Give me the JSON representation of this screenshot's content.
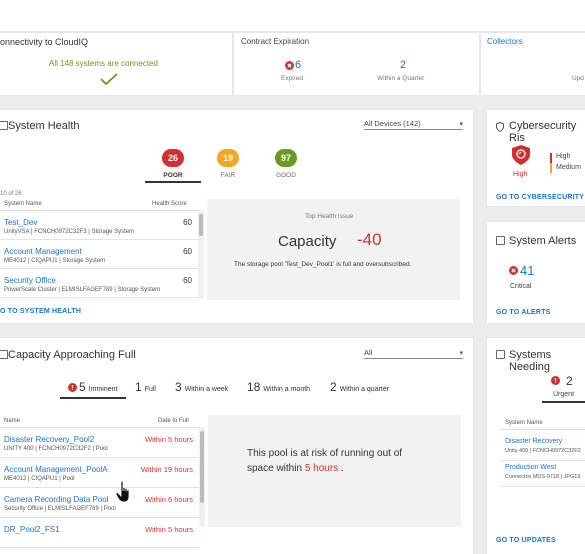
{
  "top": {
    "connectivity_title": "onnectivity to CloudIQ",
    "connectivity_status": "All 148 systems are connected",
    "contract_title": "Contract Expiration",
    "expired_count": "6",
    "expired_label": "Expired",
    "quarter_count": "2",
    "quarter_label": "Within a Quarter",
    "collectors_title": "Collectors",
    "collectors_sub": "Upd"
  },
  "system_health": {
    "title": "System Health",
    "filter": "All Devices (142)",
    "scores": [
      {
        "value": "26",
        "label": "POOR",
        "color": "#d32f2f"
      },
      {
        "value": "19",
        "label": "FAIR",
        "color": "#f5a623"
      },
      {
        "value": "97",
        "label": "GOOD",
        "color": "#6a9a1f"
      }
    ],
    "count_text": "10 of 26",
    "col_name": "System Name",
    "col_score": "Health Score",
    "rows": [
      {
        "name": "Test_Dev",
        "sub": "UnityVSA | FCNCH0972C32F3 | Storage System",
        "score": "60"
      },
      {
        "name": "Account Management",
        "sub": "ME4012 | CIQAPU1 | Storage System",
        "score": "60"
      },
      {
        "name": "Security Office",
        "sub": "PowerScale Cluster | ELMISLFAGEF789 | Storage System",
        "score": "60"
      }
    ],
    "issue_heading": "Top Health Issue",
    "issue_category": "Capacity",
    "issue_score": "-40",
    "issue_text": "The storage pool 'Test_Dev_Pool1' is full and oversubscribed.",
    "link": "O TO SYSTEM HEALTH"
  },
  "capacity": {
    "title": "Capacity Approaching Full",
    "filter": "All",
    "tabs": [
      {
        "count": "5",
        "label": "Imminent"
      },
      {
        "count": "1",
        "label": "Full"
      },
      {
        "count": "3",
        "label": "Within a week"
      },
      {
        "count": "18",
        "label": "Within a month"
      },
      {
        "count": "2",
        "label": "Within a quarter"
      }
    ],
    "col_name": "Name",
    "col_date": "Date to Full",
    "rows": [
      {
        "name": "Disaster Recovery_Pool2",
        "sub": "UNITY 400 | FCNCH0972C32F2 | Pool",
        "date": "Within 5 hours"
      },
      {
        "name": "Account Management_PoolA",
        "sub": "ME4012 | CIQAPU1 | Pool",
        "date": "Within 19 hours"
      },
      {
        "name": "Camera Recording Data Pool",
        "sub": "Security Office | ELMISLFAGEF789 | Pool",
        "date": "Within 6 hours"
      },
      {
        "name": "DR_Pool2_FS1",
        "sub": "",
        "date": "Within 5 hours"
      }
    ],
    "detail_text_1": "This pool is at risk of running out of",
    "detail_text_2": "space within ",
    "detail_highlight": "5 hours",
    "detail_end": " ."
  },
  "cyber": {
    "title": "Cybersecurity Ris",
    "risk_label": "High",
    "legend": [
      "High",
      "Medium"
    ],
    "legend_colors": [
      "#d32f2f",
      "#f5a623"
    ],
    "link": "GO TO CYBERSECURITY"
  },
  "alerts": {
    "title": "System Alerts",
    "count": "41",
    "label": "Critical",
    "link": "GO TO ALERTS"
  },
  "updates": {
    "title": "Systems Needing",
    "count": "2",
    "label": "Urgent",
    "col_name": "System Name",
    "rows": [
      {
        "name": "Disaster Recovery",
        "sub": "Unity 400 | FCNCH0972C32F2"
      },
      {
        "name": "Production West",
        "sub": "Connectrix MDS-9718 | JPG19"
      }
    ],
    "link": "GO TO UPDATES"
  }
}
